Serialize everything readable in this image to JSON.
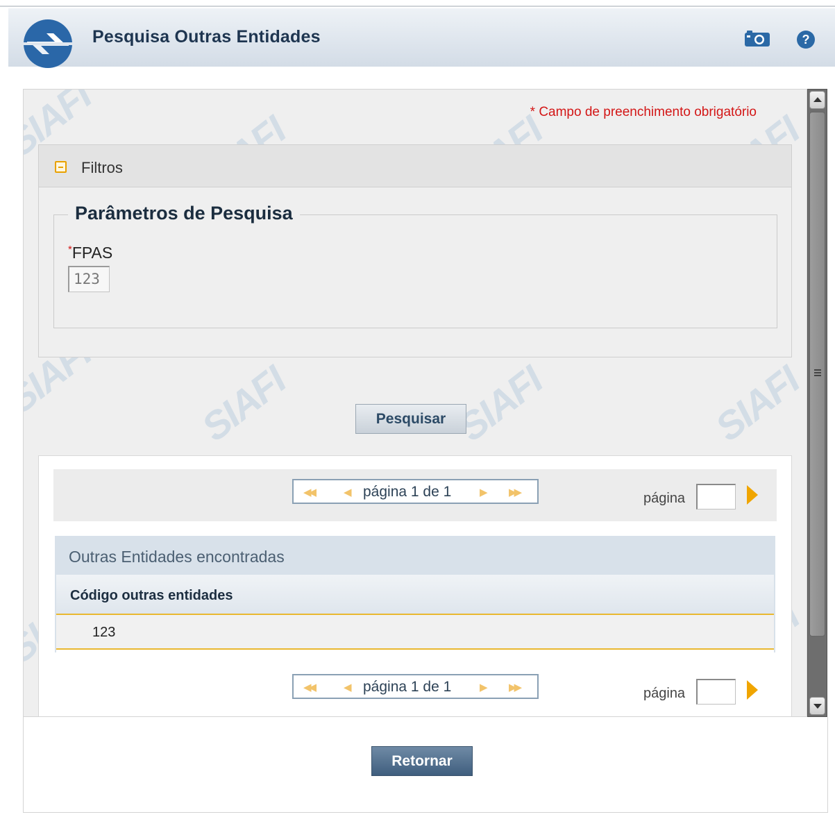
{
  "header": {
    "title": "Pesquisa Outras Entidades",
    "camera_icon": "camera-icon",
    "help_icon": "help-icon"
  },
  "form": {
    "required_note": "* Campo de preenchimento obrigatório",
    "filters_title": "Filtros",
    "fieldset_legend": "Parâmetros de Pesquisa",
    "fpas_required_mark": "*",
    "fpas_label": "FPAS",
    "fpas_value": "123",
    "search_button": "Pesquisar"
  },
  "results": {
    "pager_top": {
      "first": "◀◀",
      "prev": "◀",
      "text": "página 1 de 1",
      "next": "▶",
      "last": "▶▶",
      "goto_label": "página"
    },
    "caption": "Outras Entidades encontradas",
    "columns": [
      "Código outras entidades"
    ],
    "rows": [
      [
        "123"
      ]
    ],
    "pager_bottom": {
      "first": "◀◀",
      "prev": "◀",
      "text": "página 1 de 1",
      "next": "▶",
      "last": "▶▶",
      "goto_label": "página"
    }
  },
  "footer": {
    "return_button": "Retornar"
  },
  "watermark": "SIAFI",
  "colors": {
    "title": "#1e3550",
    "required": "#d31616",
    "accent_orange": "#f0a500",
    "return_button": "#4a6888"
  }
}
